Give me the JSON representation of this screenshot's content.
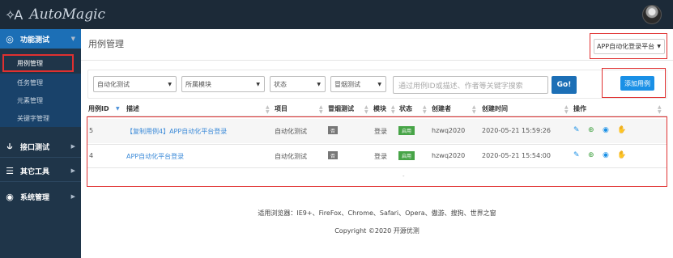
{
  "app": {
    "logo_mark": "✧A",
    "title": "AutoMagic"
  },
  "sidebar": {
    "groups": [
      {
        "label": "功能测试",
        "icon": "target-icon"
      },
      {
        "label": "接口测试",
        "icon": "interface-icon"
      },
      {
        "label": "其它工具",
        "icon": "tools-icon"
      },
      {
        "label": "系统管理",
        "icon": "settings-icon"
      }
    ],
    "subitems": [
      "用例管理",
      "任务管理",
      "元素管理",
      "关键字管理"
    ]
  },
  "header": {
    "page_title": "用例管理",
    "platform": "APP自动化登录平台"
  },
  "filters": {
    "type": "自动化测试",
    "module": "所属模块",
    "status": "状态",
    "smoke": "冒烟测试",
    "search_placeholder": "通过用例ID或描述、作者等关键字搜索",
    "go": "Go!",
    "add": "添加用例"
  },
  "table": {
    "columns": [
      "用例ID",
      "描述",
      "项目",
      "冒烟测试",
      "模块",
      "状态",
      "创建者",
      "创建时间",
      "操作"
    ],
    "rows": [
      {
        "id": "5",
        "desc": "【复制用例4】APP自动化平台登录",
        "project": "自动化测试",
        "smoke": "否",
        "module": "登录",
        "status": "启用",
        "creator": "hzwq2020",
        "created": "2020-05-21 15:59:26"
      },
      {
        "id": "4",
        "desc": "APP自动化平台登录",
        "project": "自动化测试",
        "smoke": "否",
        "module": "登录",
        "status": "启用",
        "creator": "hzwq2020",
        "created": "2020-05-21 15:54:00"
      }
    ],
    "footer_dash": "-"
  },
  "footer": {
    "browsers": "适用浏览器：IE9+、FireFox、Chrome、Safari、Opera、傲游、搜狗、世界之窗",
    "copyright": "Copyright ©2020 开源优测"
  },
  "colors": {
    "accent": "#1c6fb6",
    "topbar": "#1c2a38",
    "sidebar": "#1f3549",
    "enabled": "#47a447",
    "annotation": "#e03030"
  }
}
